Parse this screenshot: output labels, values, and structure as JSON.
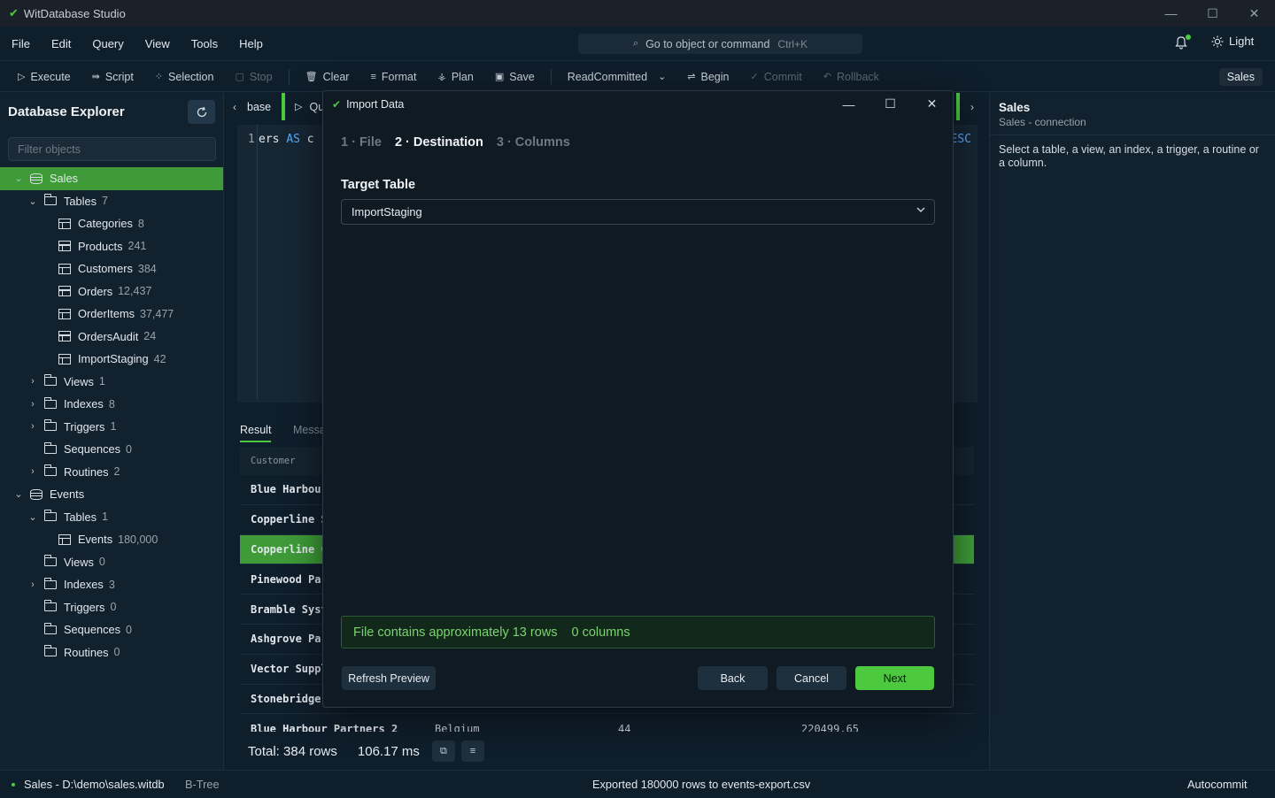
{
  "app": {
    "title": "WitDatabase Studio"
  },
  "window_controls": {
    "minimize": "—",
    "maximize": "☐",
    "close": "✕"
  },
  "menu": [
    "File",
    "Edit",
    "Query",
    "View",
    "Tools",
    "Help"
  ],
  "command_search": {
    "text": "Go to object or command",
    "shortcut": "Ctrl+K"
  },
  "theme_toggle": "Light",
  "toolbar": {
    "execute": "Execute",
    "script": "Script",
    "selection": "Selection",
    "stop": "Stop",
    "clear": "Clear",
    "format": "Format",
    "plan": "Plan",
    "save": "Save",
    "isolation": "ReadCommitted",
    "begin": "Begin",
    "commit": "Commit",
    "rollback": "Rollback",
    "connection": "Sales"
  },
  "explorer": {
    "title": "Database Explorer",
    "filter_placeholder": "Filter objects",
    "tree": [
      {
        "level": 0,
        "expander": "open",
        "icon": "db",
        "label": "Sales",
        "count": "",
        "selected": true
      },
      {
        "level": 1,
        "expander": "open",
        "icon": "folder",
        "label": "Tables",
        "count": "7"
      },
      {
        "level": 2,
        "expander": "none",
        "icon": "table",
        "label": "Categories",
        "count": "8"
      },
      {
        "level": 2,
        "expander": "none",
        "icon": "table",
        "label": "Products",
        "count": "241"
      },
      {
        "level": 2,
        "expander": "none",
        "icon": "table",
        "label": "Customers",
        "count": "384"
      },
      {
        "level": 2,
        "expander": "none",
        "icon": "table",
        "label": "Orders",
        "count": "12,437"
      },
      {
        "level": 2,
        "expander": "none",
        "icon": "table",
        "label": "OrderItems",
        "count": "37,477"
      },
      {
        "level": 2,
        "expander": "none",
        "icon": "table",
        "label": "OrdersAudit",
        "count": "24"
      },
      {
        "level": 2,
        "expander": "none",
        "icon": "table",
        "label": "ImportStaging",
        "count": "42"
      },
      {
        "level": 1,
        "expander": "closed",
        "icon": "folder",
        "label": "Views",
        "count": "1"
      },
      {
        "level": 1,
        "expander": "closed",
        "icon": "folder",
        "label": "Indexes",
        "count": "8"
      },
      {
        "level": 1,
        "expander": "closed",
        "icon": "folder",
        "label": "Triggers",
        "count": "1"
      },
      {
        "level": 1,
        "expander": "none",
        "icon": "folder",
        "label": "Sequences",
        "count": "0"
      },
      {
        "level": 1,
        "expander": "closed",
        "icon": "folder",
        "label": "Routines",
        "count": "2"
      },
      {
        "level": 0,
        "expander": "open",
        "icon": "db",
        "label": "Events",
        "count": ""
      },
      {
        "level": 1,
        "expander": "open",
        "icon": "folder",
        "label": "Tables",
        "count": "1"
      },
      {
        "level": 2,
        "expander": "none",
        "icon": "table",
        "label": "Events",
        "count": "180,000"
      },
      {
        "level": 1,
        "expander": "none",
        "icon": "folder",
        "label": "Views",
        "count": "0"
      },
      {
        "level": 1,
        "expander": "closed",
        "icon": "folder",
        "label": "Indexes",
        "count": "3"
      },
      {
        "level": 1,
        "expander": "none",
        "icon": "folder",
        "label": "Triggers",
        "count": "0"
      },
      {
        "level": 1,
        "expander": "none",
        "icon": "folder",
        "label": "Sequences",
        "count": "0"
      },
      {
        "level": 1,
        "expander": "none",
        "icon": "folder",
        "label": "Routines",
        "count": "0"
      }
    ]
  },
  "editor": {
    "tab1": "base",
    "tab2": "Qu",
    "line_no": "1",
    "code_a": "ers ",
    "code_kw": "AS",
    "code_b": " c",
    "code_right": "ESC"
  },
  "results": {
    "tab_result": "Result",
    "tab_messages": "Messa",
    "header": "Customer",
    "rows": [
      {
        "name": "Blue Harbour",
        "selected": false
      },
      {
        "name": "Copperline Sy",
        "selected": false
      },
      {
        "name": "Copperline Co",
        "selected": true
      },
      {
        "name": "Pinewood Part",
        "selected": false
      },
      {
        "name": "Bramble Syste",
        "selected": false
      },
      {
        "name": "Ashgrove Part",
        "selected": false
      },
      {
        "name": "Vector Supply",
        "selected": false
      },
      {
        "name": "Stonebridge I",
        "selected": false
      }
    ],
    "last_row": {
      "name": "Blue Harbour Partners 2",
      "country": "Belgium",
      "orders": "44",
      "total": "220499.65"
    },
    "total_rows": "Total: 384 rows",
    "elapsed": "106.17 ms"
  },
  "properties": {
    "title": "Sales",
    "subtitle": "Sales - connection",
    "hint": "Select a table, a view, an index, a trigger, a routine or a column."
  },
  "statusbar": {
    "connection": "Sales - D:\\demo\\sales.witdb",
    "engine": "B-Tree",
    "message": "Exported 180000 rows to events-export.csv",
    "mode": "Autocommit"
  },
  "modal": {
    "title": "Import Data",
    "steps": [
      {
        "label": "1 · File",
        "active": false
      },
      {
        "label": "2 · Destination",
        "active": true
      },
      {
        "label": "3 · Columns",
        "active": false
      }
    ],
    "target_label": "Target Table",
    "target_value": "ImportStaging",
    "file_info": "File contains approximately 13 rows",
    "file_columns": "0 columns",
    "refresh": "Refresh Preview",
    "back": "Back",
    "cancel": "Cancel",
    "next": "Next"
  },
  "colors": {
    "accent": "#4cc93f",
    "background": "#0f1e2b",
    "panel": "#12212e"
  }
}
